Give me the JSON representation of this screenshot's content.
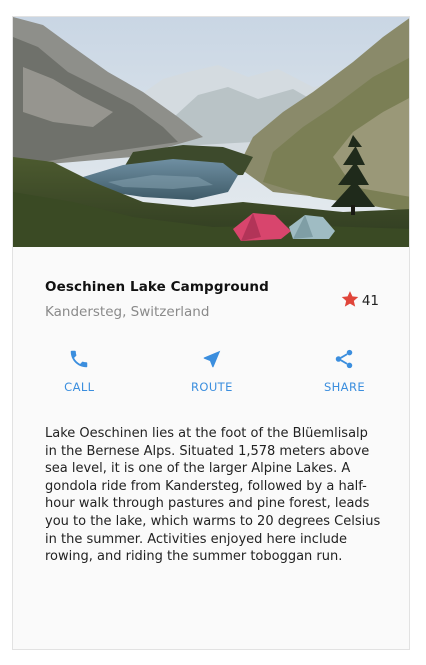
{
  "place": {
    "title": "Oeschinen Lake Campground",
    "location": "Kandersteg, Switzerland",
    "rating_count": "41"
  },
  "actions": [
    {
      "label": "CALL",
      "icon": "phone-icon"
    },
    {
      "label": "ROUTE",
      "icon": "navigation-arrow-icon"
    },
    {
      "label": "SHARE",
      "icon": "share-icon"
    }
  ],
  "description": "Lake Oeschinen lies at the foot of the Blüemlisalp in the Bernese Alps. Situated 1,578 meters above sea level, it is one of the larger Alpine Lakes. A gondola ride from Kandersteg, followed by a half-hour walk through pastures and pine forest, leads you to the lake, which warms to 20 degrees Celsius in the summer. Activities enjoyed here include rowing, and riding the summer toboggan run.",
  "colors": {
    "accent": "#3b8ede",
    "star": "#e0453a",
    "subtitle": "#8a8a8a"
  },
  "icons": {
    "rating": "star-icon"
  }
}
